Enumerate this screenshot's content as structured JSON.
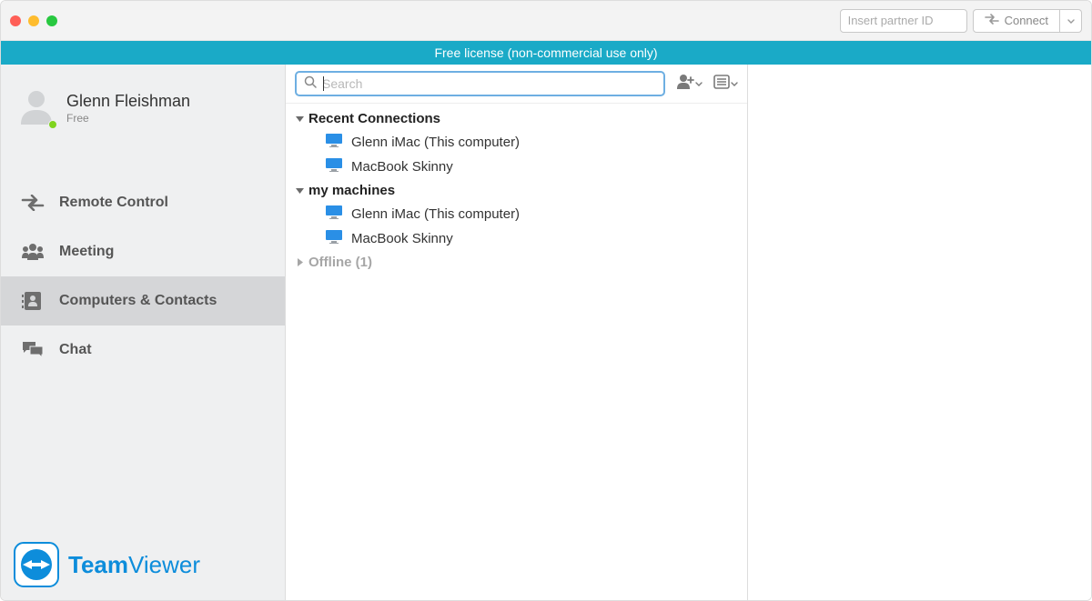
{
  "titlebar": {
    "partner_id_placeholder": "Insert partner ID",
    "connect_label": "Connect"
  },
  "banner": {
    "text": "Free license (non-commercial use only)"
  },
  "user": {
    "name": "Glenn Fleishman",
    "subtitle": "Free"
  },
  "nav": {
    "items": [
      {
        "label": "Remote Control"
      },
      {
        "label": "Meeting"
      },
      {
        "label": "Computers & Contacts"
      },
      {
        "label": "Chat"
      }
    ]
  },
  "search": {
    "placeholder": "Search"
  },
  "groups": [
    {
      "expanded": true,
      "label": "Recent Connections",
      "items": [
        {
          "label": "Glenn iMac (This computer)"
        },
        {
          "label": "MacBook Skinny"
        }
      ]
    },
    {
      "expanded": true,
      "label": "my machines",
      "items": [
        {
          "label": "Glenn iMac (This computer)"
        },
        {
          "label": "MacBook Skinny"
        }
      ]
    },
    {
      "expanded": false,
      "label": "Offline (1)",
      "items": []
    }
  ],
  "logo": {
    "team": "Team",
    "viewer": "Viewer"
  }
}
